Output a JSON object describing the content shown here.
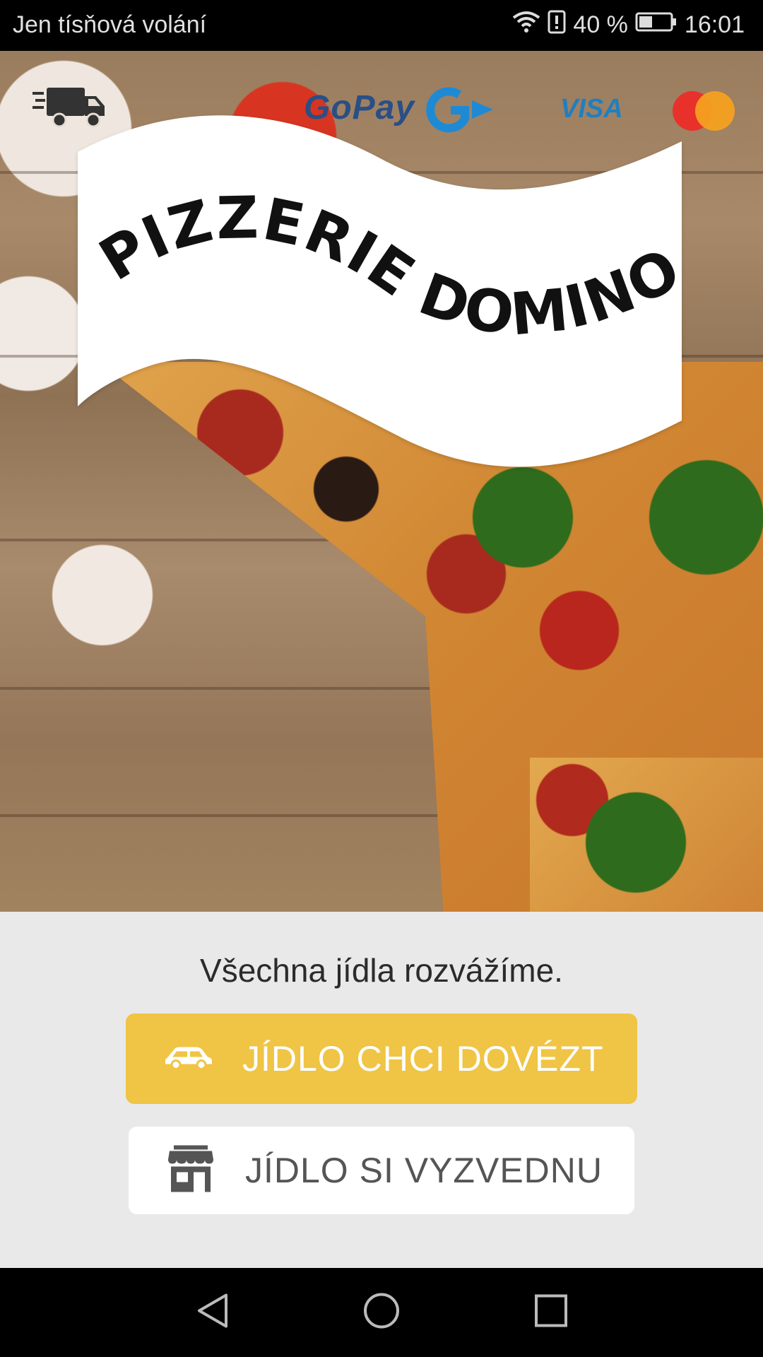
{
  "status_bar": {
    "carrier": "Jen tísňová volání",
    "battery_percent": "40 %",
    "time": "16:01",
    "icons": [
      "wifi-icon",
      "alert-icon",
      "battery-icon"
    ]
  },
  "header_icons": {
    "delivery_icon": "truck-icon",
    "gopay_label": "GoPay",
    "gopay_icon": "gopay-g-icon",
    "visa_label": "VISA",
    "mastercard_icon": "mastercard-icon"
  },
  "banner": {
    "title": "PIZZERIE DOMINO"
  },
  "main": {
    "tagline": "Všechna jídla rozvážíme.",
    "delivery_button": {
      "label": "JÍDLO CHCI DOVÉZT",
      "icon": "car-icon"
    },
    "pickup_button": {
      "label": "JÍDLO SI VYZVEDNU",
      "icon": "store-icon"
    }
  },
  "colors": {
    "accent": "#f0c444",
    "background": "#e9e9e9",
    "pickup_text": "#555555"
  },
  "nav_bar": {
    "icons": [
      "back-icon",
      "home-icon",
      "recents-icon"
    ]
  }
}
